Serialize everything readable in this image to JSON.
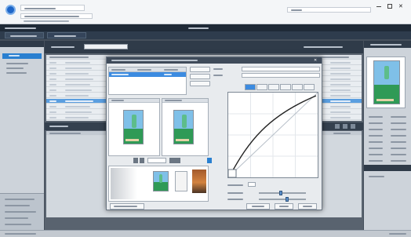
{
  "browser": {
    "tab_title": "",
    "url": "",
    "search": ""
  },
  "app": {
    "title": "",
    "tabs": [
      "",
      ""
    ]
  },
  "left_panel": {
    "items": [
      "",
      "",
      "",
      ""
    ],
    "bottom_items": [
      "",
      "",
      "",
      ""
    ]
  },
  "file_list": {
    "columns": [
      "",
      "",
      "",
      ""
    ],
    "rows": 11,
    "selected_row": 8
  },
  "dialog": {
    "title": "",
    "list_columns": [
      "",
      "",
      ""
    ],
    "side_buttons": [
      "",
      "",
      ""
    ],
    "property_labels": [
      "",
      "",
      ""
    ],
    "preview_labels": [
      "",
      ""
    ],
    "zoom_label": "",
    "curve_tabs": [
      "",
      "",
      "",
      "",
      "",
      ""
    ],
    "slider_labels": [
      "",
      ""
    ],
    "footer_buttons": [
      "",
      "",
      ""
    ]
  },
  "colors": {
    "accent": "#2a80d0",
    "app_dark": "#1f2a37",
    "selection": "#3c8be0"
  }
}
